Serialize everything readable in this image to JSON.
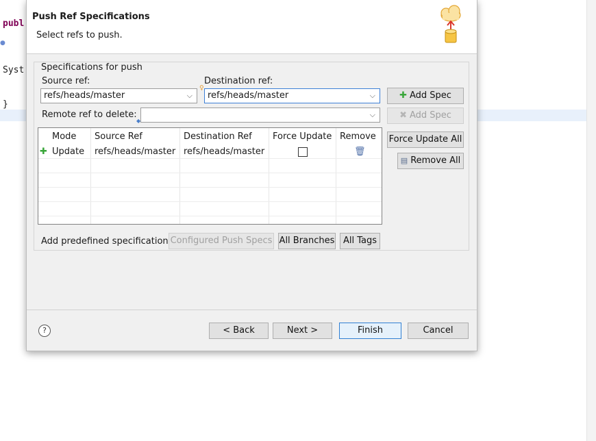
{
  "editor": {
    "line1": "publ",
    "line2": "Syst",
    "line3": "}"
  },
  "dialog": {
    "title": "Push Ref Specifications",
    "subtitle": "Select refs to push."
  },
  "group": {
    "legend": "Specifications for push",
    "source_label": "Source ref:",
    "source_value": "refs/heads/master",
    "dest_label": "Destination ref:",
    "dest_value": "refs/heads/master",
    "add_spec_label": "Add Spec",
    "remote_delete_label": "Remote ref to delete:",
    "remote_delete_value": "",
    "add_spec_disabled_label": "Add Spec",
    "force_update_all_label": "Force Update All",
    "remove_all_label": "Remove All"
  },
  "table": {
    "columns": [
      "Mode",
      "Source Ref",
      "Destination Ref",
      "Force Update",
      "Remove"
    ],
    "rows": [
      {
        "mode": "Update",
        "source": "refs/heads/master",
        "destination": "refs/heads/master",
        "force_update": false
      }
    ]
  },
  "predefined": {
    "label": "Add predefined specification",
    "configured_label": "Configured Push Specs",
    "all_branches_label": "All Branches",
    "all_tags_label": "All Tags"
  },
  "footer": {
    "back_label": "< Back",
    "next_label": "Next >",
    "finish_label": "Finish",
    "cancel_label": "Cancel"
  },
  "icons": {
    "help": "help-icon",
    "add": "plus-icon",
    "delete": "x-icon",
    "remove_all": "remove-all-icon",
    "trash": "trash-icon",
    "wizard": "cloud-upload-database-icon"
  },
  "colors": {
    "accent": "#2f7fd3",
    "add_green": "#39a63a",
    "keyword": "#7f0055"
  }
}
